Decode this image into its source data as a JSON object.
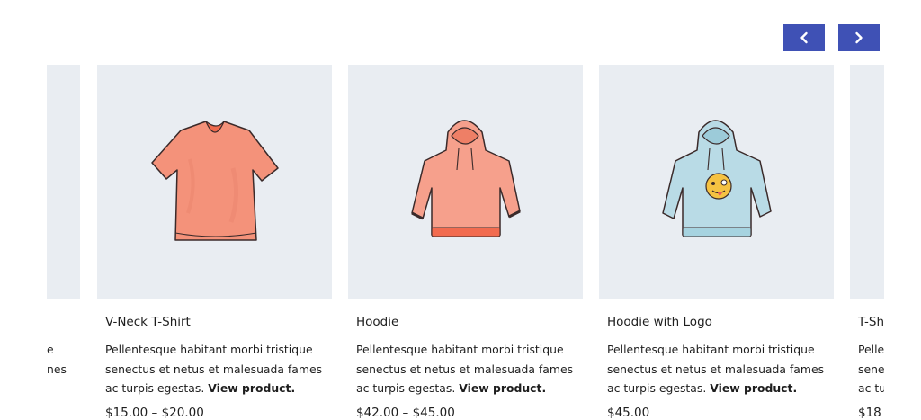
{
  "carousel": {
    "prev_icon": "chevron-left-icon",
    "next_icon": "chevron-right-icon",
    "accent_color": "#3f51b5",
    "image_bg": "#e9edf2"
  },
  "left_partial": {
    "line1": "e",
    "line2": "nes"
  },
  "products": [
    {
      "title": "V-Neck T-Shirt",
      "desc_line1": "Pellentesque habitant morbi tristique",
      "desc_line2": "senectus et netus et malesuada fames",
      "desc_line3": "ac turpis egestas.",
      "link": "View product.",
      "price": "$15.00 – $20.00",
      "image": "v-neck-tshirt-illustration"
    },
    {
      "title": "Hoodie",
      "desc_line1": "Pellentesque habitant morbi tristique",
      "desc_line2": "senectus et netus et malesuada fames",
      "desc_line3": "ac turpis egestas.",
      "link": "View product.",
      "price": "$42.00 – $45.00",
      "image": "hoodie-illustration"
    },
    {
      "title": "Hoodie with Logo",
      "desc_line1": "Pellentesque habitant morbi tristique",
      "desc_line2": "senectus et netus et malesuada fames",
      "desc_line3": "ac turpis egestas.",
      "link": "View product.",
      "price": "$45.00",
      "image": "hoodie-with-logo-illustration"
    }
  ],
  "right_partial": {
    "title": "T-Sh",
    "line1": "Pelle",
    "line2": "sene",
    "line3": "ac tu",
    "price": "$18"
  }
}
